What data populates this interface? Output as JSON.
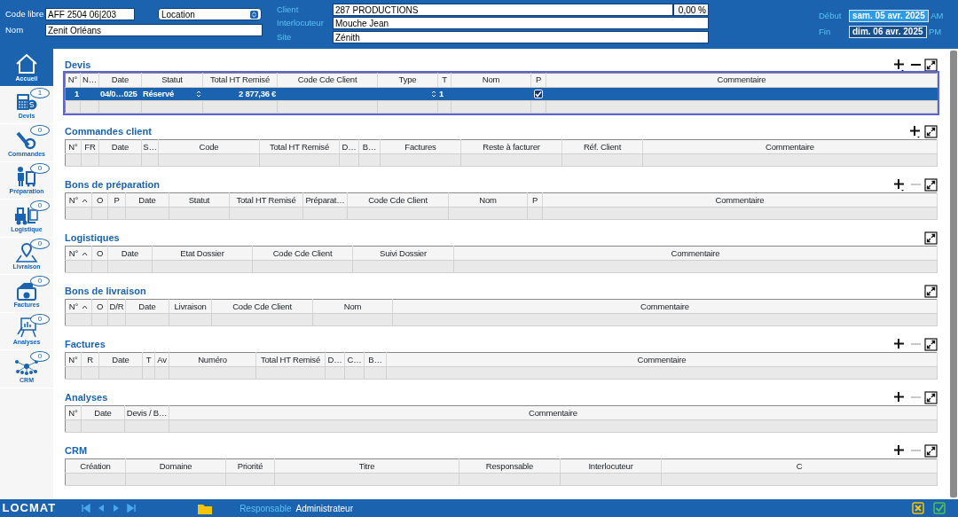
{
  "header": {
    "code_libre": {
      "label": "Code libre",
      "value": "AFF 2504 06|203"
    },
    "type_select": {
      "value": "Location"
    },
    "nom": {
      "label": "Nom",
      "value": "Zenit Orléans"
    },
    "client": {
      "label": "Client",
      "value": "287 PRODUCTIONS",
      "discount": "0,00 %"
    },
    "interlocuteur": {
      "label": "Interlocuteur",
      "value": "Mouche Jean"
    },
    "site": {
      "label": "Site",
      "value": "Zénith"
    },
    "dates": [
      {
        "label": "Début",
        "value": "sam. 05 avr. 2025",
        "period": "AM",
        "selected": true
      },
      {
        "label": "Fin",
        "value": "dim. 06 avr. 2025",
        "period": "PM",
        "selected": false
      }
    ]
  },
  "sidebar": {
    "items": [
      {
        "label": "Accueil",
        "selected": true
      },
      {
        "label": "Devis",
        "count": "1",
        "selected": false
      },
      {
        "label": "Commandes",
        "count": "0",
        "selected": false
      },
      {
        "label": "Préparation",
        "count": "0",
        "selected": false
      },
      {
        "label": "Logistique",
        "count": "0",
        "selected": false
      },
      {
        "label": "Livraison",
        "count": "0",
        "selected": false
      },
      {
        "label": "Factures",
        "count": "0",
        "selected": false
      },
      {
        "label": "Analyses",
        "count": "0",
        "selected": false
      },
      {
        "label": "CRM",
        "count": "0",
        "selected": false
      }
    ]
  },
  "sections": [
    {
      "title": "Devis",
      "focused": true,
      "tools": [
        {
          "kind": "add",
          "menu": true,
          "disabled": false
        },
        {
          "kind": "remove",
          "disabled": false
        },
        {
          "kind": "collapse",
          "disabled": false
        }
      ],
      "columns": [
        {
          "label": "N°",
          "kind": "number"
        },
        {
          "label": "N…",
          "kind": "text"
        },
        {
          "label": "Date",
          "kind": "text"
        },
        {
          "label": "Statut",
          "kind": "select"
        },
        {
          "label": "Total HT Remisé",
          "kind": "number"
        },
        {
          "label": "Code Cde Client",
          "kind": "text"
        },
        {
          "label": "Type",
          "kind": "select"
        },
        {
          "label": "T",
          "kind": "text"
        },
        {
          "label": "Nom",
          "kind": "text"
        },
        {
          "label": "P",
          "kind": "check"
        },
        {
          "label": "Commentaire",
          "kind": "text"
        }
      ],
      "rows": [
        {
          "selected": true,
          "cells": [
            "1",
            "",
            "04/0…025",
            "Réservé",
            "2 877,36 €",
            "",
            "",
            "1",
            "",
            {
              "checked": true
            },
            ""
          ]
        }
      ]
    },
    {
      "title": "Commandes client",
      "focused": false,
      "tools": [
        {
          "kind": "add",
          "menu": true,
          "disabled": false
        },
        {
          "kind": "collapse",
          "disabled": false
        }
      ],
      "columns": [
        {
          "label": "N°"
        },
        {
          "label": "FR"
        },
        {
          "label": "Date"
        },
        {
          "label": "S…"
        },
        {
          "label": "Code"
        },
        {
          "label": "Total HT Remisé"
        },
        {
          "label": "D…"
        },
        {
          "label": "B…"
        },
        {
          "label": "Factures"
        },
        {
          "label": "Reste à facturer"
        },
        {
          "label": "Réf. Client"
        },
        {
          "label": "Commentaire"
        }
      ]
    },
    {
      "title": "Bons de préparation",
      "focused": false,
      "tools": [
        {
          "kind": "add",
          "menu": true,
          "disabled": false
        },
        {
          "kind": "remove",
          "disabled": true
        },
        {
          "kind": "collapse",
          "disabled": false
        }
      ],
      "columns": [
        {
          "label": "N°",
          "sorted": true
        },
        {
          "label": "O"
        },
        {
          "label": "P"
        },
        {
          "label": "Date"
        },
        {
          "label": "Statut"
        },
        {
          "label": "Total HT Remisé"
        },
        {
          "label": "Préparat…"
        },
        {
          "label": "Code Cde Client"
        },
        {
          "label": "Nom"
        },
        {
          "label": "P"
        },
        {
          "label": "Commentaire"
        }
      ]
    },
    {
      "title": "Logistiques",
      "focused": false,
      "tools": [
        {
          "kind": "collapse",
          "disabled": false
        }
      ],
      "columns": [
        {
          "label": "N°",
          "sorted": true
        },
        {
          "label": "O"
        },
        {
          "label": "Date"
        },
        {
          "label": "Etat Dossier"
        },
        {
          "label": "Code Cde Client"
        },
        {
          "label": "Suivi Dossier"
        },
        {
          "label": "Commentaire"
        }
      ]
    },
    {
      "title": "Bons de livraison",
      "focused": false,
      "tools": [
        {
          "kind": "collapse",
          "disabled": false
        }
      ],
      "columns": [
        {
          "label": "N°",
          "sorted": true
        },
        {
          "label": "O"
        },
        {
          "label": "D/R"
        },
        {
          "label": "Date"
        },
        {
          "label": "Livraison"
        },
        {
          "label": "Code Cde Client"
        },
        {
          "label": "Nom"
        },
        {
          "label": "Commentaire"
        }
      ]
    },
    {
      "title": "Factures",
      "focused": false,
      "tools": [
        {
          "kind": "add",
          "menu": false,
          "disabled": false
        },
        {
          "kind": "remove",
          "disabled": true
        },
        {
          "kind": "collapse",
          "disabled": false
        }
      ],
      "columns": [
        {
          "label": "N°"
        },
        {
          "label": "R"
        },
        {
          "label": "Date"
        },
        {
          "label": "T"
        },
        {
          "label": "Av"
        },
        {
          "label": "Numéro"
        },
        {
          "label": "Total HT Remisé"
        },
        {
          "label": "D…"
        },
        {
          "label": "C…"
        },
        {
          "label": "B…"
        },
        {
          "label": "Commentaire"
        }
      ]
    },
    {
      "title": "Analyses",
      "focused": false,
      "tools": [
        {
          "kind": "add",
          "menu": false,
          "disabled": false
        },
        {
          "kind": "remove",
          "disabled": true
        },
        {
          "kind": "collapse",
          "disabled": false
        }
      ],
      "columns": [
        {
          "label": "N°"
        },
        {
          "label": "Date"
        },
        {
          "label": "Devis / B…"
        },
        {
          "label": "Commentaire"
        }
      ]
    },
    {
      "title": "CRM",
      "focused": false,
      "tools": [
        {
          "kind": "add",
          "menu": false,
          "disabled": false
        },
        {
          "kind": "remove",
          "disabled": true
        },
        {
          "kind": "collapse",
          "disabled": false
        }
      ],
      "columns": [
        {
          "label": "Création"
        },
        {
          "label": "Domaine"
        },
        {
          "label": "Priorité"
        },
        {
          "label": "Titre"
        },
        {
          "label": "Responsable"
        },
        {
          "label": "Interlocuteur"
        },
        {
          "label": "C"
        }
      ]
    }
  ],
  "status_bar": {
    "logo": "LOCMAT",
    "responsable_label": "Responsable",
    "responsable_value": "Administrateur"
  }
}
